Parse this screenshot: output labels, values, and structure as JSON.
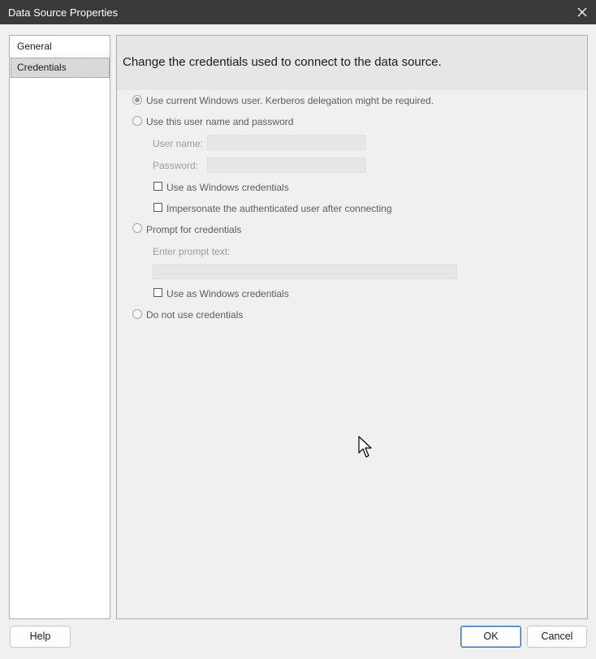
{
  "window": {
    "title": "Data Source Properties",
    "close_icon": "close-icon"
  },
  "nav": {
    "items": [
      {
        "label": "General",
        "selected": false
      },
      {
        "label": "Credentials",
        "selected": true
      }
    ]
  },
  "page": {
    "heading": "Change the credentials used to connect to the data source.",
    "options": {
      "current_user": {
        "label": "Use current Windows user. Kerberos delegation might be required.",
        "selected": true
      },
      "user_password": {
        "label": "Use this user name and password",
        "selected": false,
        "username_label": "User name:",
        "username_value": "",
        "password_label": "Password:",
        "password_value": "",
        "windows_credentials_label": "Use as Windows credentials",
        "windows_credentials_checked": false,
        "impersonate_label": "Impersonate the authenticated user after connecting",
        "impersonate_checked": false
      },
      "prompt": {
        "label": "Prompt for credentials",
        "selected": false,
        "prompt_text_label": "Enter prompt text:",
        "prompt_text_value": "",
        "windows_credentials_label": "Use as Windows credentials",
        "windows_credentials_checked": false
      },
      "no_credentials": {
        "label": "Do not use credentials",
        "selected": false
      }
    }
  },
  "footer": {
    "help_label": "Help",
    "ok_label": "OK",
    "cancel_label": "Cancel"
  },
  "colors": {
    "titlebar": "#3a3a3a",
    "dialog_background": "#f0f0f0",
    "header_background": "#e6e6e6",
    "default_button_border": "#2a6ebf"
  }
}
